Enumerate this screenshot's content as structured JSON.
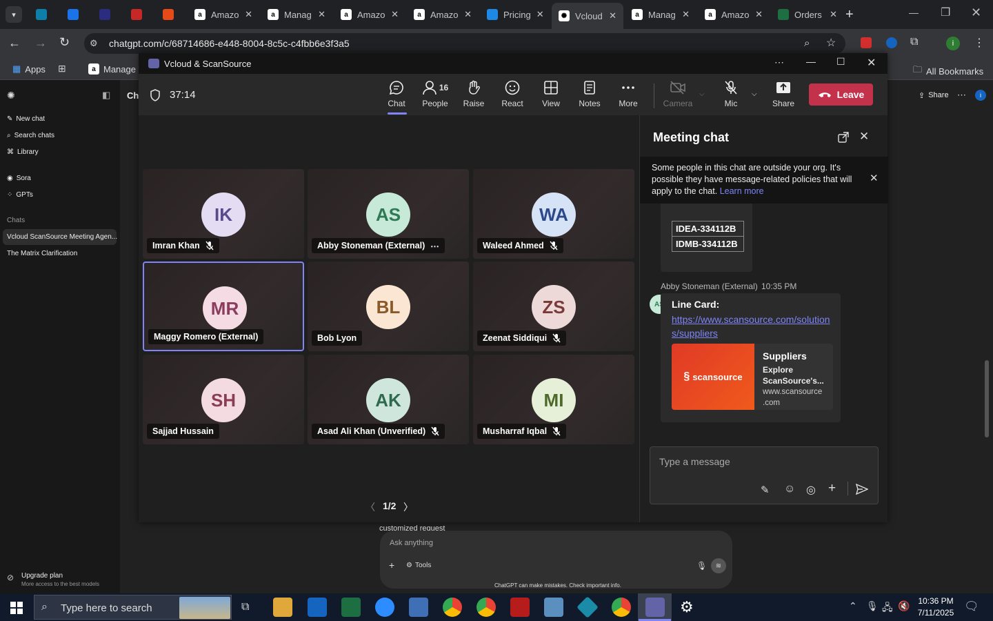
{
  "browser": {
    "tabs": [
      {
        "label": "",
        "fav": "#0e7fa8",
        "icon": "app-icon"
      },
      {
        "label": "",
        "fav": "#1a73e8",
        "icon": "ec-icon"
      },
      {
        "label": "",
        "fav": "#2b2b80",
        "icon": "tu-icon"
      },
      {
        "label": "",
        "fav": "#c62828",
        "icon": "tab-icon"
      },
      {
        "label": "",
        "fav": "#e64a19",
        "icon": "box-icon"
      },
      {
        "label": "Amazo",
        "fav": "#ffffff",
        "icon": "amazon-icon"
      },
      {
        "label": "Manag",
        "fav": "#ffffff",
        "icon": "amazon-icon"
      },
      {
        "label": "Amazo",
        "fav": "#ffffff",
        "icon": "amazon-icon"
      },
      {
        "label": "Amazo",
        "fav": "#ffffff",
        "icon": "amazon-icon"
      },
      {
        "label": "Pricing",
        "fav": "#1e88e5",
        "icon": "dollar-icon"
      },
      {
        "label": "Vcloud",
        "fav": "#ffffff",
        "icon": "chatgpt-icon",
        "active": true
      },
      {
        "label": "Manag",
        "fav": "#ffffff",
        "icon": "amazon-icon"
      },
      {
        "label": "Amazo",
        "fav": "#ffffff",
        "icon": "amazon-icon"
      },
      {
        "label": "Orders",
        "fav": "#1d6f42",
        "icon": "excel-icon"
      }
    ],
    "url": "chatgpt.com/c/68714686-e448-8004-8c5c-c4fbb6e3f3a5",
    "bookmarks": {
      "apps": "Apps",
      "manage": "Manage Y",
      "all": "All Bookmarks"
    }
  },
  "gpt": {
    "sidebar": {
      "new_chat": "New chat",
      "search": "Search chats",
      "library": "Library",
      "sora": "Sora",
      "gpts": "GPTs",
      "chats_heading": "Chats",
      "chat1": "Vcloud ScanSource Meeting Agen...",
      "chat2": "The Matrix Clarification",
      "upgrade": "Upgrade plan",
      "upgrade_sub": "More access to the best models"
    },
    "header_partial": "Cha",
    "share": "Share",
    "partial_text": "customized request",
    "ask_placeholder": "Ask anything",
    "tools": "Tools",
    "disclaimer": "ChatGPT can make mistakes. Check important info."
  },
  "teams": {
    "window_title": "Vcloud & ScanSource",
    "timer": "37:14",
    "toolbar": {
      "chat": "Chat",
      "people": "People",
      "people_count": "16",
      "raise": "Raise",
      "react": "React",
      "view": "View",
      "notes": "Notes",
      "more": "More",
      "camera": "Camera",
      "mic": "Mic",
      "share": "Share",
      "leave": "Leave"
    },
    "participants": [
      {
        "initials": "IK",
        "name": "Imran Khan",
        "muted": true,
        "bg": "#e3dcf2",
        "fg": "#5b4a8b"
      },
      {
        "initials": "AS",
        "name": "Abby Stoneman (External)",
        "muted": false,
        "more": true,
        "bg": "#c7ead8",
        "fg": "#2f7a55"
      },
      {
        "initials": "WA",
        "name": "Waleed Ahmed",
        "muted": true,
        "bg": "#d6e2f5",
        "fg": "#2c4a8a"
      },
      {
        "initials": "MR",
        "name": "Maggy Romero (External)",
        "muted": false,
        "speaking": true,
        "bg": "#f4dbe4",
        "fg": "#8a3d5c"
      },
      {
        "initials": "BL",
        "name": "Bob Lyon",
        "muted": false,
        "bg": "#fbe6d4",
        "fg": "#8a5a2a"
      },
      {
        "initials": "ZS",
        "name": "Zeenat Siddiqui",
        "muted": true,
        "bg": "#eed9d9",
        "fg": "#7a3b3b"
      },
      {
        "initials": "SH",
        "name": "Sajjad Hussain",
        "muted": false,
        "bg": "#f4dbe2",
        "fg": "#8a3d55"
      },
      {
        "initials": "AK",
        "name": "Asad Ali Khan (Unverified)",
        "muted": true,
        "bg": "#cfe6dc",
        "fg": "#2f6a4f"
      },
      {
        "initials": "MI",
        "name": "Musharraf Iqbal",
        "muted": true,
        "bg": "#e6efd8",
        "fg": "#4d6a2a"
      }
    ],
    "pager": "1/2",
    "chat": {
      "title": "Meeting chat",
      "notice": "Some people in this chat are outside your org. It's possible they have message-related policies that will apply to the chat.",
      "learn_more": "Learn more",
      "code1": "IDEA-334112B",
      "code2": "IDMB-334112B",
      "sender": "Abby Stoneman (External)",
      "time": "10:35 PM",
      "avatar": "AS",
      "msg_title": "Line Card:",
      "link": "https://www.scansource.com/solutions/suppliers",
      "link_line1": "https://www.scansource.com/solution",
      "link_line2": "s/suppliers",
      "preview_logo": "scansource",
      "preview_title": "Suppliers",
      "preview_desc1": "Explore",
      "preview_desc2": "ScanSource's...",
      "preview_domain1": "www.scansource",
      "preview_domain2": ".com",
      "input_placeholder": "Type a message"
    }
  },
  "taskbar": {
    "search": "Type here to search",
    "time": "10:36 PM",
    "date": "7/11/2025"
  },
  "colors": {
    "teams_accent": "#7f85f5",
    "leave": "#c4314b",
    "link": "#7f85f5"
  }
}
